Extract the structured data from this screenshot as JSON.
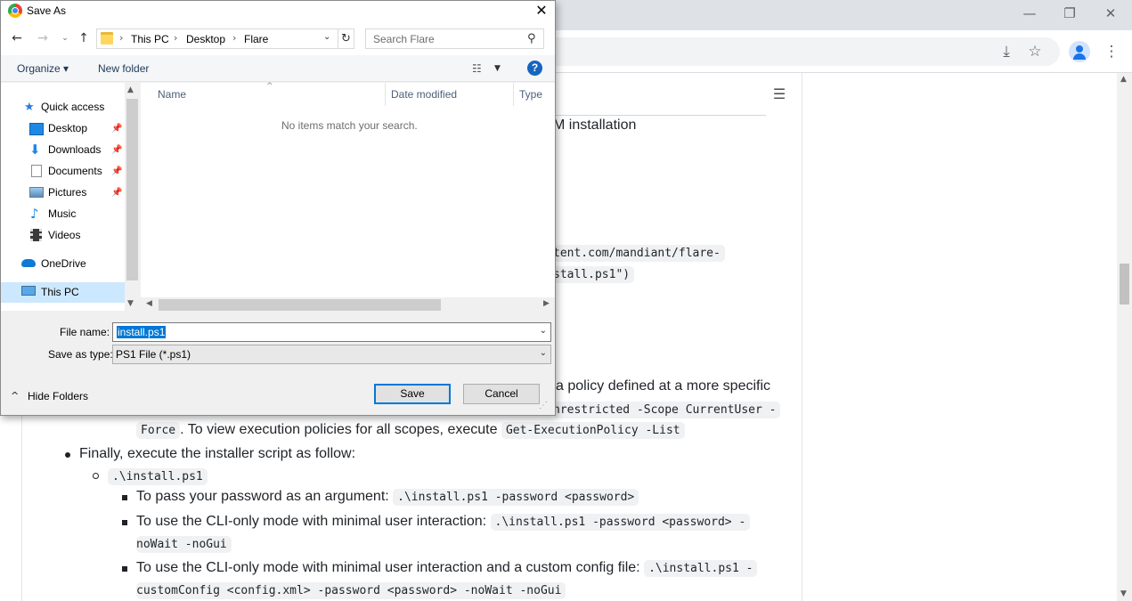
{
  "dialog": {
    "title": "Save As",
    "breadcrumb": [
      "This PC",
      "Desktop",
      "Flare"
    ],
    "search_placeholder": "Search Flare",
    "organize_label": "Organize ▾",
    "new_folder_label": "New folder",
    "help_label": "?",
    "nav_items": [
      {
        "label": "Quick access",
        "icon": "star-icon"
      },
      {
        "label": "Desktop",
        "icon": "desktop-folder-icon",
        "pinned": true
      },
      {
        "label": "Downloads",
        "icon": "download-arrow-icon",
        "pinned": true
      },
      {
        "label": "Documents",
        "icon": "documents-icon",
        "pinned": true
      },
      {
        "label": "Pictures",
        "icon": "pictures-icon",
        "pinned": true
      },
      {
        "label": "Music",
        "icon": "music-note-icon"
      },
      {
        "label": "Videos",
        "icon": "videos-icon"
      },
      {
        "label": "OneDrive",
        "icon": "cloud-icon"
      },
      {
        "label": "This PC",
        "icon": "computer-icon",
        "selected": true
      }
    ],
    "columns": [
      "Name",
      "Date modified",
      "Type"
    ],
    "empty_message": "No items match your search.",
    "file_name_label": "File name:",
    "file_name_value": "install.ps1",
    "save_type_label": "Save as type:",
    "save_type_value": "PS1 File (*.ps1)",
    "hide_folders_label": "Hide Folders",
    "save_label": "Save",
    "cancel_label": "Cancel"
  },
  "page": {
    "frag_heading": "M installation",
    "frag_url_1": "tent.com/mandiant/flare-",
    "frag_url_2": "stall.ps1\")",
    "frag_policy": "a policy defined at a more specific",
    "frag_cmd": "nrestricted -Scope CurrentUser -",
    "force_code": "Force",
    "view_policies_text": ". To view execution policies for all scopes, execute",
    "get_policy_code": "Get-ExecutionPolicy -List",
    "finally_text": "Finally, execute the installer script as follow:",
    "install_code": ".\\install.ps1",
    "pass_pw_text": "To pass your password as an argument:",
    "pass_pw_code": ".\\install.ps1 -password <password>",
    "cli_text": "To use the CLI-only mode with minimal user interaction:",
    "cli_code_1": ".\\install.ps1 -password <password> -",
    "cli_code_2": "noWait -noGui",
    "cli_cfg_text": "To use the CLI-only mode with minimal user interaction and a custom config file:",
    "cli_cfg_code_1": ".\\install.ps1 -",
    "cli_cfg_code_2": "customConfig <config.xml> -password <password> -noWait -noGui"
  }
}
